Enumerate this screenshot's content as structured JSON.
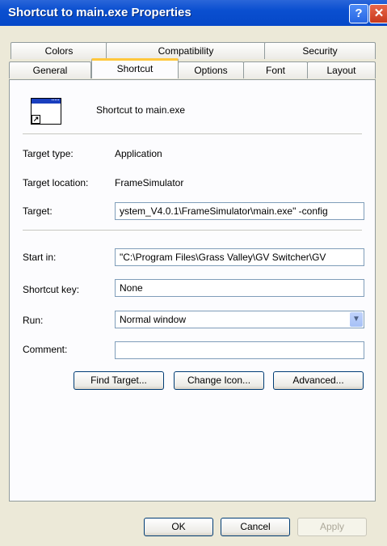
{
  "window": {
    "title": "Shortcut to main.exe Properties",
    "help_glyph": "?",
    "close_glyph": "✕"
  },
  "tabs": {
    "row1": [
      "Colors",
      "Compatibility",
      "Security"
    ],
    "row2": [
      "General",
      "Shortcut",
      "Options",
      "Font",
      "Layout"
    ],
    "active": "Shortcut"
  },
  "shortcut": {
    "name": "Shortcut to main.exe",
    "target_type_label": "Target type:",
    "target_type_value": "Application",
    "target_location_label": "Target location:",
    "target_location_value": "FrameSimulator",
    "target_label": "Target:",
    "target_value": "ystem_V4.0.1\\FrameSimulator\\main.exe\" -config",
    "start_in_label": "Start in:",
    "start_in_value": "\"C:\\Program Files\\Grass Valley\\GV Switcher\\GV",
    "shortcut_key_label": "Shortcut key:",
    "shortcut_key_value": "None",
    "run_label": "Run:",
    "run_value": "Normal window",
    "comment_label": "Comment:",
    "comment_value": ""
  },
  "buttons": {
    "find_target": "Find Target...",
    "change_icon": "Change Icon...",
    "advanced": "Advanced...",
    "ok": "OK",
    "cancel": "Cancel",
    "apply": "Apply"
  },
  "colors": {
    "titlebar": "#0a4fd0",
    "active_tab_accent": "#ffc73c",
    "dialog_bg": "#ece9d8"
  }
}
